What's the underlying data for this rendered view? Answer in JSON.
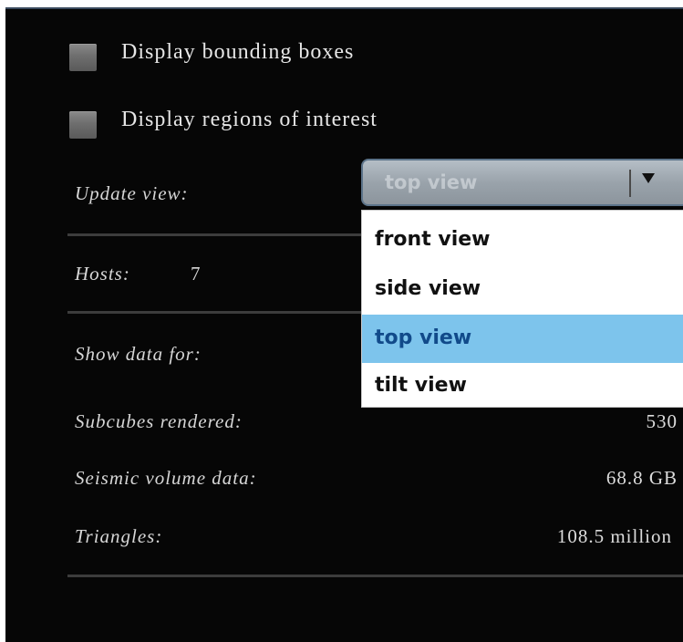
{
  "options": {
    "bounding_boxes": {
      "label": "Display bounding boxes",
      "checked": false
    },
    "regions_of_interest": {
      "label": "Display regions of interest",
      "checked": false
    }
  },
  "update_view": {
    "label": "Update view:",
    "selected": "top view",
    "options": [
      "front view",
      "side view",
      "top view",
      "tilt view"
    ]
  },
  "hosts": {
    "label": "Hosts:",
    "value": "7"
  },
  "show_data_for": {
    "label": "Show data for:"
  },
  "stats": {
    "subcubes": {
      "label": "Subcubes rendered:",
      "value": "530"
    },
    "seismic": {
      "label": "Seismic volume data:",
      "value": "68.8 GB"
    },
    "triangles": {
      "label": "Triangles:",
      "value": "108.5 million"
    }
  },
  "colors": {
    "panel_bg": "#060606",
    "highlight": "#7dc4ec",
    "highlight_text": "#114a8a"
  }
}
